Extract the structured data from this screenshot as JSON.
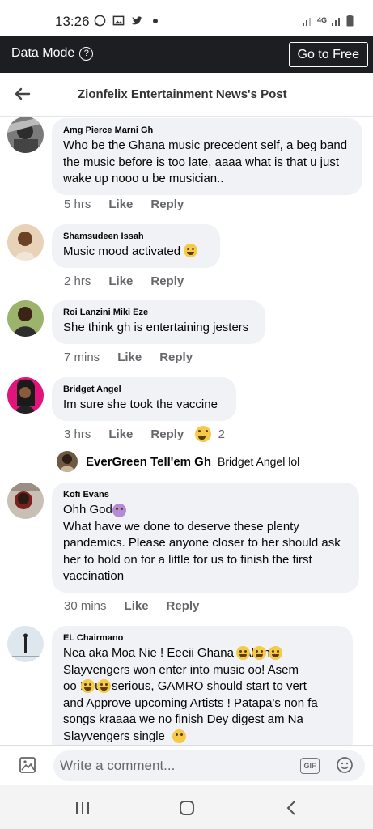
{
  "status_bar": {
    "time": "13:26",
    "network": "4G"
  },
  "data_bar": {
    "mode_label": "Data Mode",
    "help_glyph": "?",
    "go_free_label": "Go to Free"
  },
  "header": {
    "title": "Zionfelix Entertainment News's Post"
  },
  "comments": [
    {
      "name": "Amg Pierce Marni Gh",
      "text": "Who be the Ghana music precedent self, a beg band\nthe music before is too late, aaaa what is that u just\nwake up nooo u be musician..",
      "time": "5 hrs",
      "like": "Like",
      "reply": "Reply"
    },
    {
      "name": "Shamsudeen Issah",
      "text": "Music mood activated",
      "time": "2 hrs",
      "like": "Like",
      "reply": "Reply"
    },
    {
      "name": "Roi Lanzini Miki Eze",
      "text": "She think gh is entertaining jesters",
      "time": "7 mins",
      "like": "Like",
      "reply": "Reply"
    },
    {
      "name": "Bridget Angel",
      "text": "Im sure she took the vaccine",
      "time": "3 hrs",
      "like": "Like",
      "reply": "Reply",
      "reaction_count": "2"
    },
    {
      "name": "Kofi Evans",
      "text": "Ohh God\nWhat have we done to deserve these plenty\npandemics. Please anyone closer to her should ask\nher to hold on for a little for us to finish the first\nvaccination",
      "time": "30 mins",
      "like": "Like",
      "reply": "Reply"
    },
    {
      "name": "EL Chairmano",
      "text": "Nea aka Moa Nie ! Eeeii Ghana         ! All the\nSlayvengers won enter into music oo! Asem\noo        ! Buh serious, GAMRO should start to vert\nand Approve upcoming Artists ! Patapa's non fa\nsongs kraaaa we no finish Dey digest  am Na\nSlayvengers single"
    }
  ],
  "reply_preview": {
    "name": "EverGreen Tell'em Gh",
    "text": "Bridget Angel lol"
  },
  "composer": {
    "placeholder": "Write a comment...",
    "gif_label": "GIF"
  },
  "colors": {
    "dark_bar": "#1c1e21",
    "bubble": "#f0f2f5",
    "muted": "#65676b"
  }
}
